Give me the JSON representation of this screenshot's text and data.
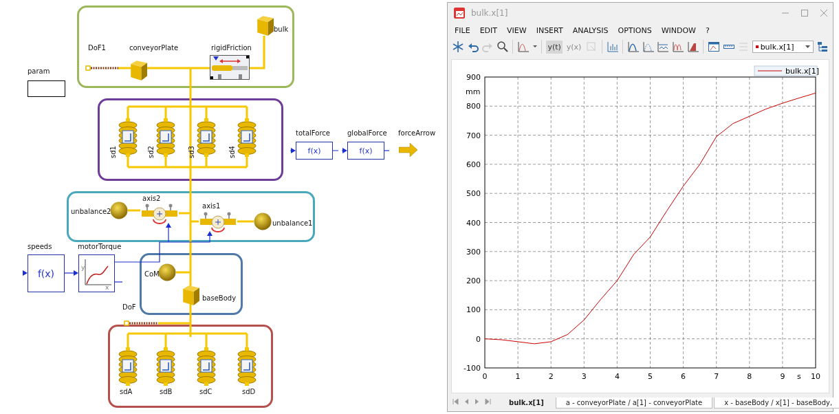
{
  "diagram": {
    "groups": [
      {
        "color": "#9cb85a"
      },
      {
        "color": "#6f3d98"
      },
      {
        "color": "#4aa8bc"
      },
      {
        "color": "#4f79a8"
      },
      {
        "color": "#b5504c"
      }
    ],
    "components": [
      {
        "kind": "port",
        "label": "DoF1"
      },
      {
        "kind": "body",
        "label": "conveyorPlate"
      },
      {
        "kind": "friction",
        "label": "rigidFriction"
      },
      {
        "kind": "body",
        "label": "bulk"
      },
      {
        "kind": "parameter",
        "label": "param"
      },
      {
        "kind": "spring",
        "label": "sd1"
      },
      {
        "kind": "spring",
        "label": "sd2"
      },
      {
        "kind": "spring",
        "label": "sd3"
      },
      {
        "kind": "spring",
        "label": "sd4"
      },
      {
        "kind": "function",
        "label": "totalForce",
        "text": "f(x)"
      },
      {
        "kind": "function",
        "label": "globalForce",
        "text": "f(x)"
      },
      {
        "kind": "arrow",
        "label": "forceArrow"
      },
      {
        "kind": "revolute",
        "label": "axis2"
      },
      {
        "kind": "sphere",
        "label": "unbalance2"
      },
      {
        "kind": "revolute",
        "label": "axis1"
      },
      {
        "kind": "sphere",
        "label": "unbalance1"
      },
      {
        "kind": "function",
        "label": "speeds",
        "text": "f(x)"
      },
      {
        "kind": "table",
        "label": "motorTorque",
        "axis_labels": [
          "y",
          "x"
        ]
      },
      {
        "kind": "sphere",
        "label": "CoM"
      },
      {
        "kind": "body",
        "label": "baseBody"
      },
      {
        "kind": "port",
        "label": "DoF"
      },
      {
        "kind": "spring",
        "label": "sdA"
      },
      {
        "kind": "spring",
        "label": "sdB"
      },
      {
        "kind": "spring",
        "label": "sdC"
      },
      {
        "kind": "spring",
        "label": "sdD"
      }
    ]
  },
  "plot_window": {
    "title": "bulk.x[1]",
    "menu": [
      "FILE",
      "EDIT",
      "VIEW",
      "INSERT",
      "ANALYSIS",
      "OPTIONS",
      "WINDOW",
      "?"
    ],
    "toolbar": {
      "text_buttons": [
        {
          "label": "y(t)",
          "selected": true,
          "disabled": false
        },
        {
          "label": "y(x)",
          "selected": false,
          "disabled": true
        }
      ],
      "variable_combo": "bulk.x[1]"
    },
    "chart_data": {
      "type": "line",
      "grid": true,
      "xlabel": "s",
      "ylabel": "mm",
      "xlim": [
        0,
        10
      ],
      "ylim": [
        -100,
        900
      ],
      "xticks": [
        0,
        1,
        2,
        3,
        4,
        5,
        6,
        7,
        8,
        9,
        10
      ],
      "yticks": [
        -100,
        0,
        100,
        200,
        300,
        400,
        500,
        600,
        700,
        800,
        900
      ],
      "x": [
        0,
        0.5,
        1,
        1.5,
        2,
        2.5,
        3,
        3.5,
        4,
        4.5,
        5,
        5.5,
        6,
        6.5,
        7,
        7.5,
        8,
        8.5,
        9,
        9.5,
        10
      ],
      "series": [
        {
          "name": "bulk.x[1]",
          "color": "#cc0000",
          "values": [
            0,
            -3,
            -10,
            -17,
            -10,
            15,
            65,
            135,
            200,
            290,
            350,
            440,
            525,
            600,
            695,
            740,
            765,
            790,
            810,
            828,
            845
          ]
        }
      ]
    },
    "tabs": [
      {
        "label": "bulk.x[1]",
        "selected": true
      },
      {
        "label": "a - conveyorPlate / a[1] - conveyorPlate",
        "selected": false
      },
      {
        "label": "x - baseBody / x[1] - baseBody,",
        "selected": false
      }
    ]
  }
}
